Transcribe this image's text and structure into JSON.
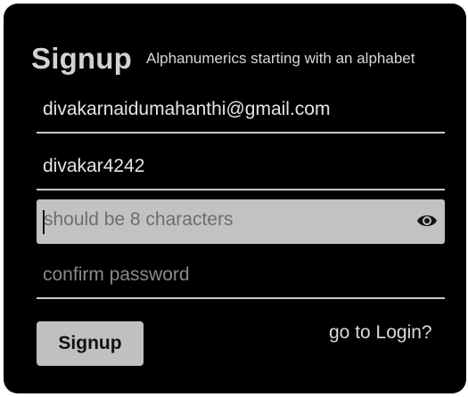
{
  "header": {
    "title": "Signup",
    "hint": "Alphanumerics starting with an alphabet"
  },
  "fields": {
    "email_value": "divakarnaidumahanthi@gmail.com",
    "username_value": "divakar4242",
    "password_placeholder": "should be 8 characters",
    "confirm_placeholder": "confirm password"
  },
  "actions": {
    "signup_label": "Signup",
    "login_link": "go to Login?"
  },
  "icons": {
    "password_toggle": "eye-icon"
  },
  "colors": {
    "card_background": "#000000",
    "focused_field": "#c2c2c2",
    "button": "#c0c0c0"
  }
}
